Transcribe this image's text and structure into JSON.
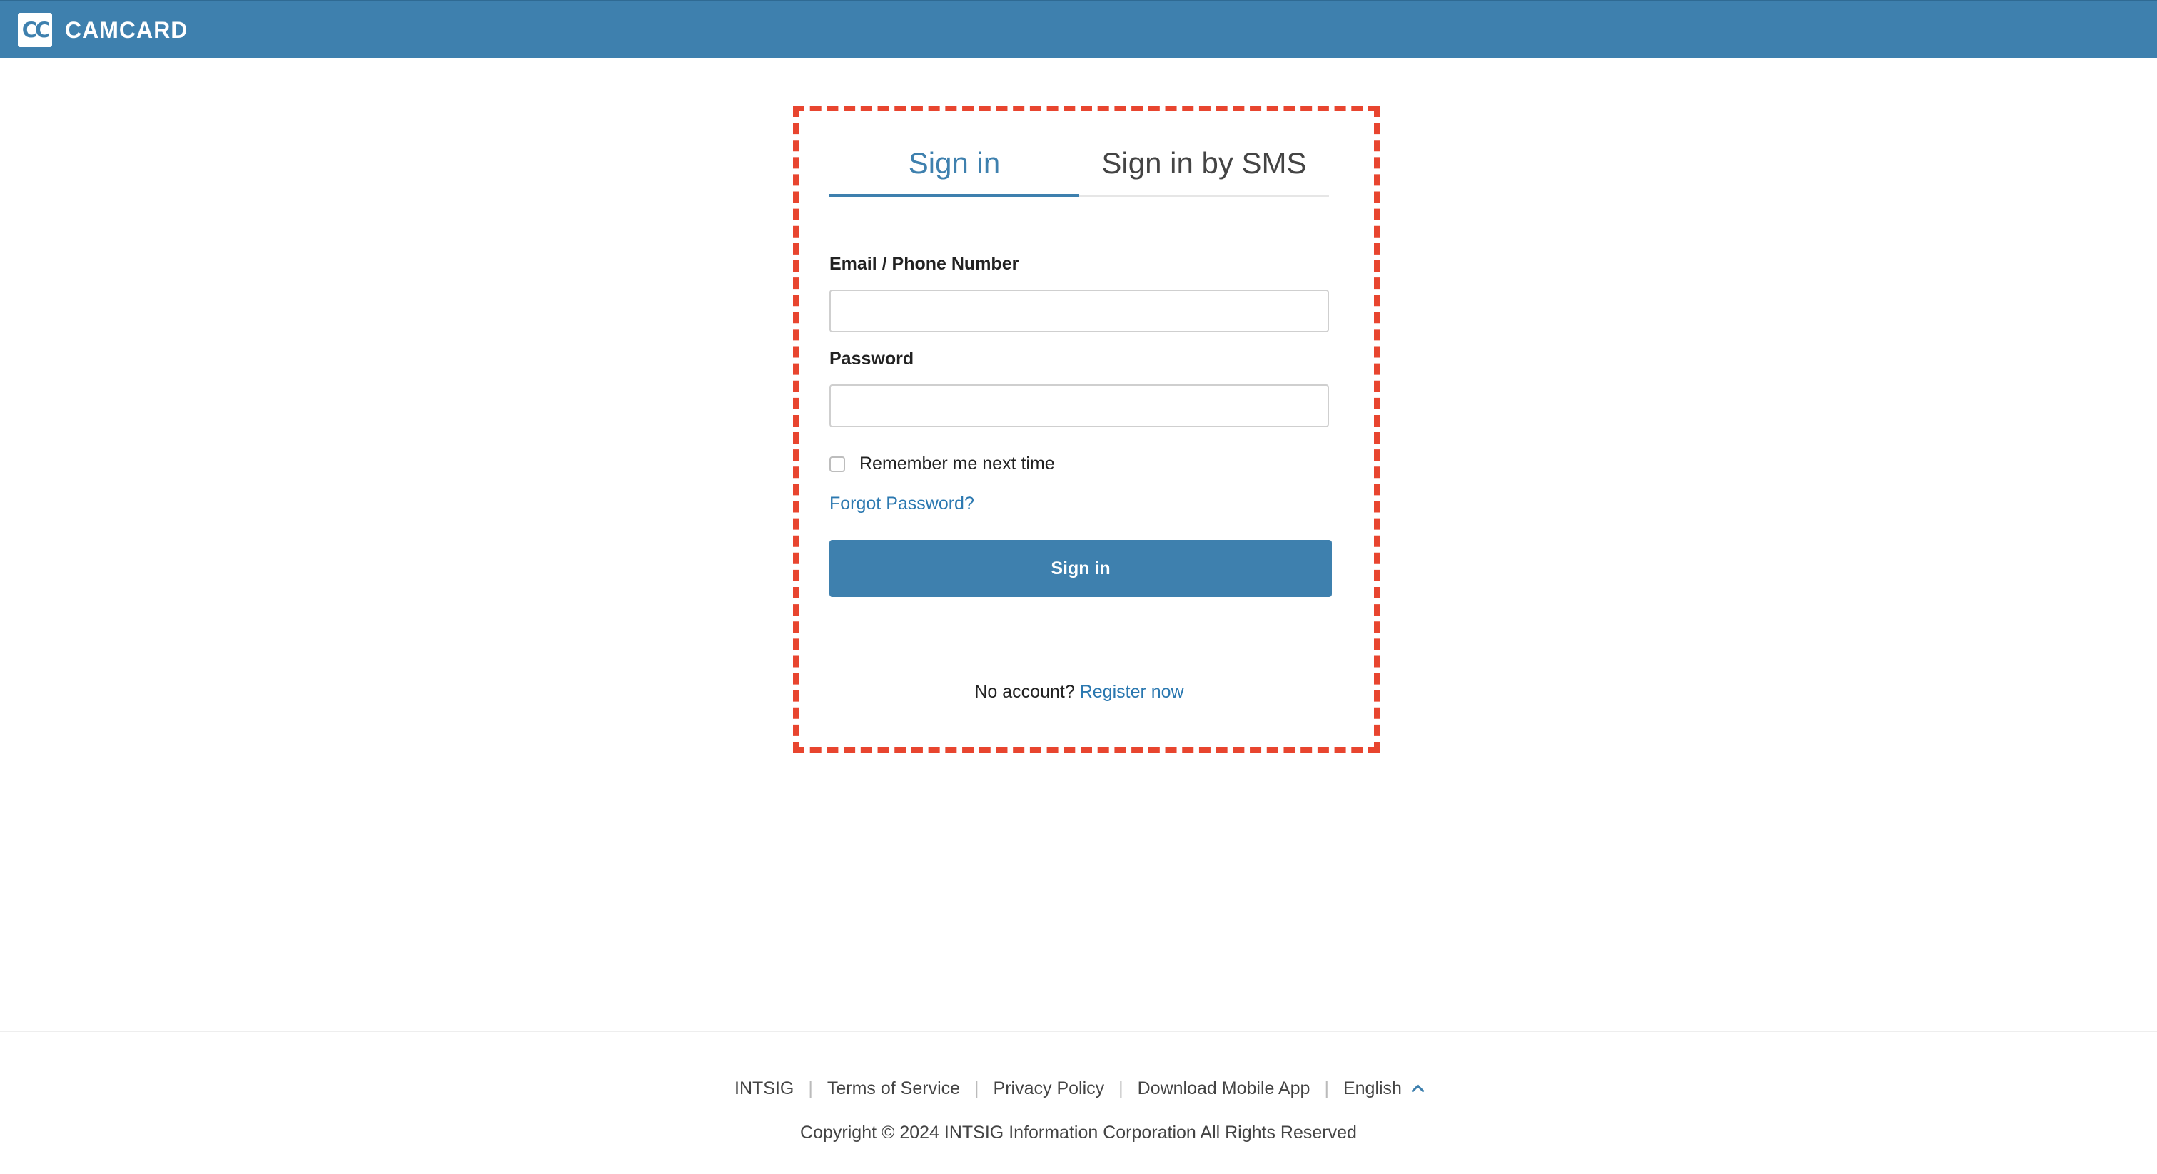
{
  "header": {
    "logo_mark": "CC",
    "logo_text": "CAMCARD"
  },
  "login": {
    "tabs": [
      {
        "label": "Sign in",
        "active": true
      },
      {
        "label": "Sign in by SMS",
        "active": false
      }
    ],
    "email_label": "Email / Phone Number",
    "email_value": "",
    "password_label": "Password",
    "password_value": "",
    "remember_label": "Remember me next time",
    "remember_checked": false,
    "forgot_label": "Forgot Password?",
    "signin_button": "Sign in",
    "no_account_text": "No account?",
    "register_label": "Register now"
  },
  "footer": {
    "links": [
      "INTSIG",
      "Terms of Service",
      "Privacy Policy",
      "Download Mobile App"
    ],
    "language": "English",
    "copyright": "Copyright © 2024 INTSIG Information Corporation All Rights Reserved"
  },
  "colors": {
    "brand": "#3e80ae",
    "link": "#2b78b0",
    "highlight_border": "#e8452f"
  }
}
